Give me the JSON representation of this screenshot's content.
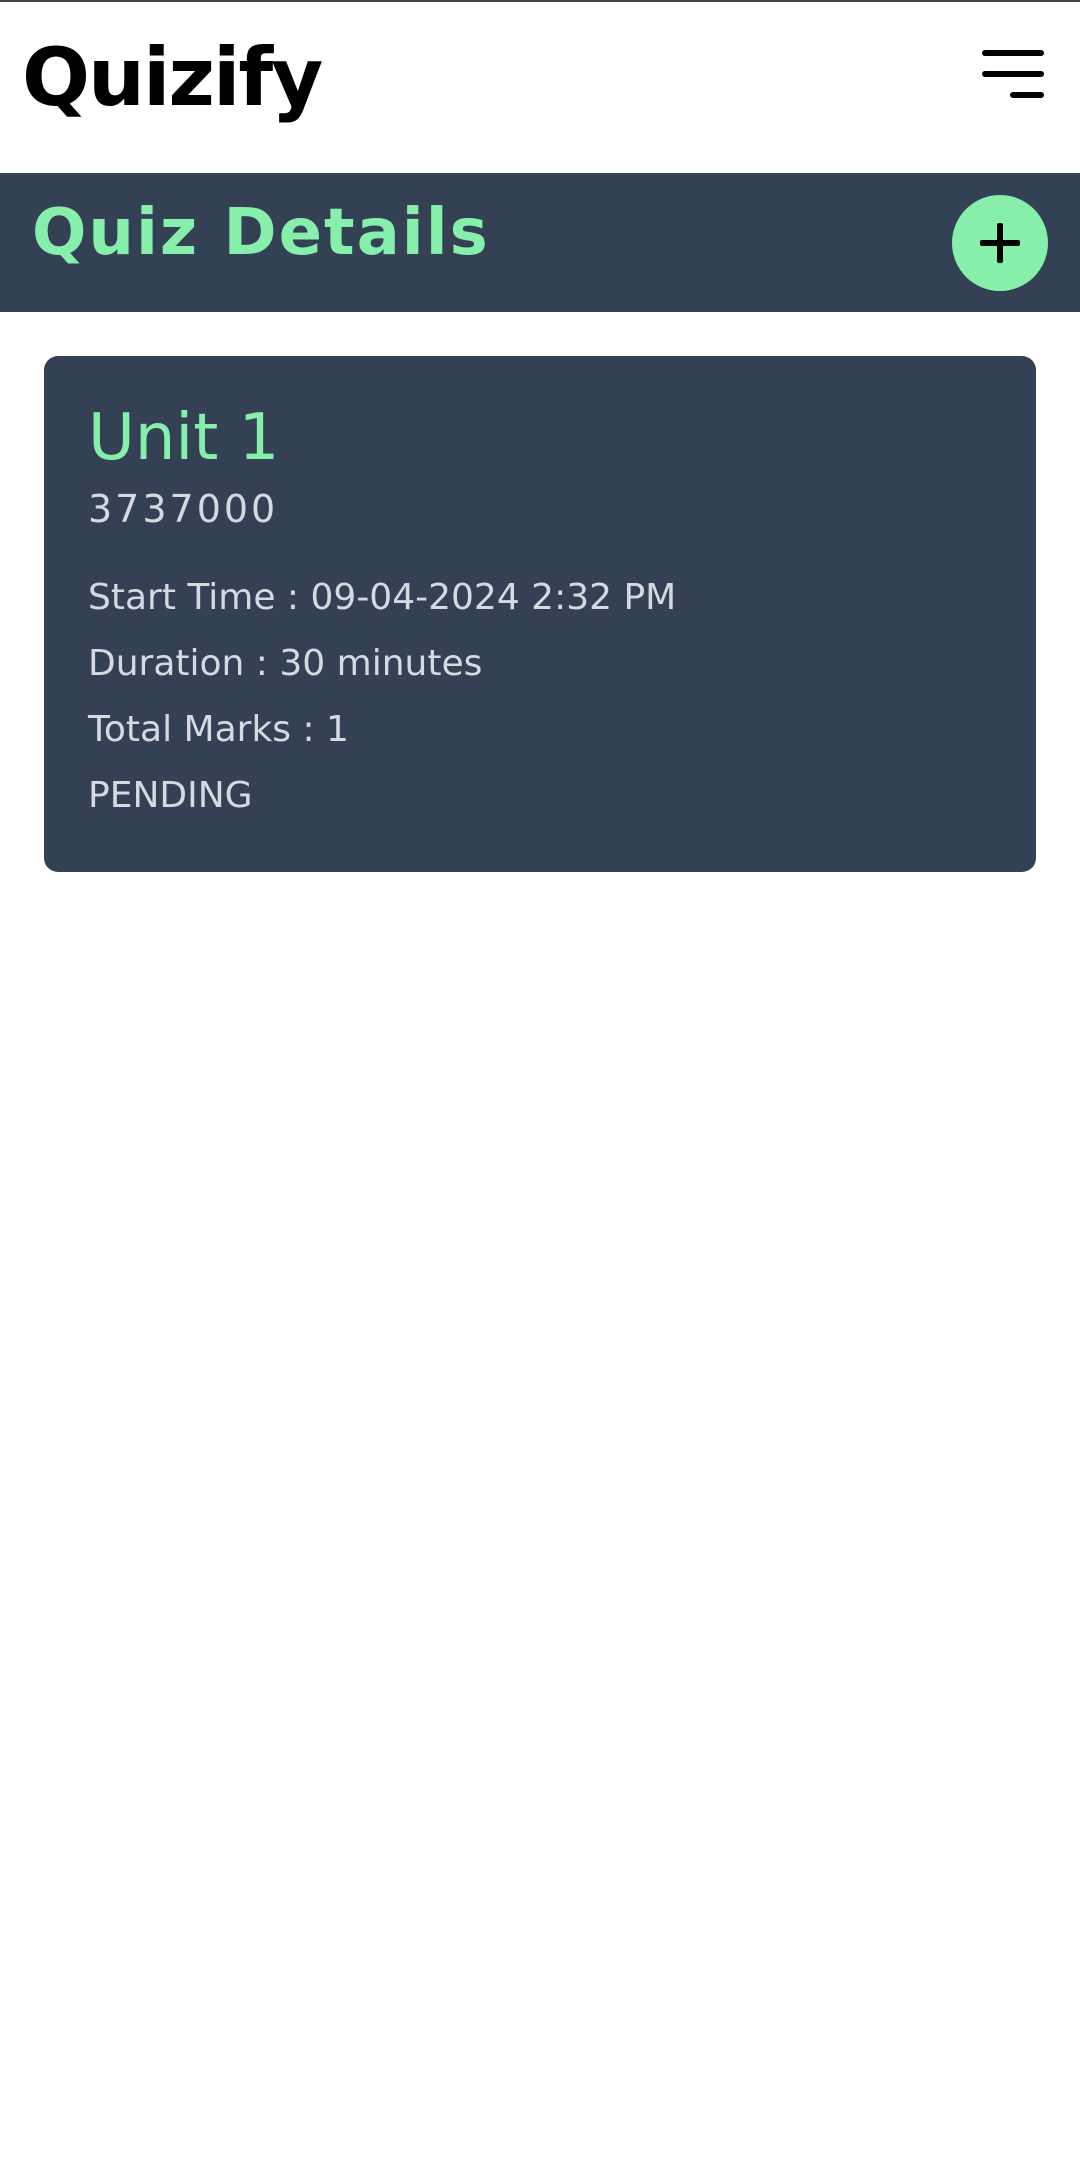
{
  "header": {
    "logo": "Quizify",
    "menu_icon": "hamburger-menu-icon"
  },
  "section": {
    "title": "Quiz Details",
    "add_icon": "plus-icon"
  },
  "quiz": {
    "title": "Unit 1",
    "code": "3737000",
    "start_time": "Start Time : 09-04-2024 2:32 PM",
    "duration": "Duration : 30 minutes",
    "total_marks": "Total Marks : 1",
    "status": "PENDING"
  },
  "colors": {
    "accent": "#86efac",
    "panel": "#344154",
    "card_text": "#d5d9e0",
    "logo": "#000000"
  }
}
